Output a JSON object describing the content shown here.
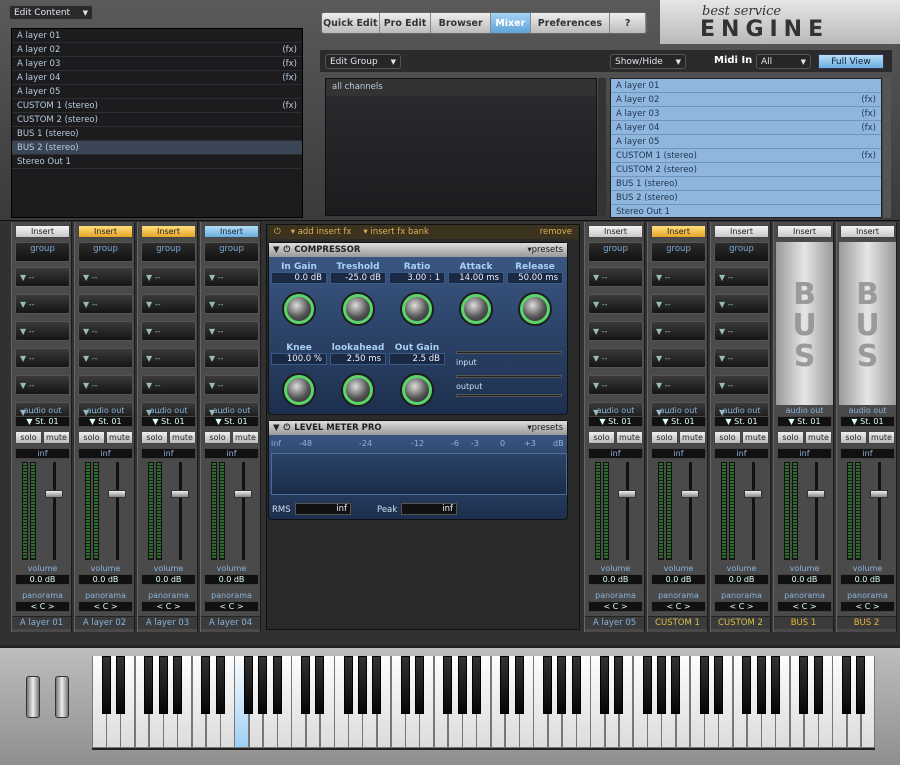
{
  "header": {
    "edit_content": "Edit Content",
    "brand_small": "best service",
    "brand_big": "ENGINE",
    "tabs": [
      {
        "label": "Quick Edit",
        "active": false
      },
      {
        "label": "Pro Edit",
        "active": false
      },
      {
        "label": "Browser",
        "active": false
      },
      {
        "label": "Mixer",
        "active": true
      },
      {
        "label": "Preferences",
        "active": false
      },
      {
        "label": "?",
        "active": false
      }
    ]
  },
  "left_list": [
    {
      "name": "A layer 01",
      "fx": ""
    },
    {
      "name": "A layer 02",
      "fx": "(fx)"
    },
    {
      "name": "A layer 03",
      "fx": "(fx)"
    },
    {
      "name": "A layer 04",
      "fx": "(fx)"
    },
    {
      "name": "A layer 05",
      "fx": ""
    },
    {
      "name": "CUSTOM 1 (stereo)",
      "fx": "(fx)"
    },
    {
      "name": "CUSTOM 2 (stereo)",
      "fx": ""
    },
    {
      "name": "BUS 1 (stereo)",
      "fx": ""
    },
    {
      "name": "BUS 2 (stereo)",
      "fx": ""
    },
    {
      "name": "Stereo Out 1",
      "fx": ""
    }
  ],
  "group_bar": {
    "edit_group": "Edit Group",
    "show_hide": "Show/Hide",
    "midi_in": "Midi In",
    "midi_value": "All",
    "full_view": "Full View",
    "all_channels": "all channels"
  },
  "right_list": [
    {
      "name": "A layer 01",
      "fx": ""
    },
    {
      "name": "A layer 02",
      "fx": "(fx)"
    },
    {
      "name": "A layer 03",
      "fx": "(fx)"
    },
    {
      "name": "A layer 04",
      "fx": "(fx)"
    },
    {
      "name": "A layer 05",
      "fx": ""
    },
    {
      "name": "CUSTOM 1 (stereo)",
      "fx": "(fx)"
    },
    {
      "name": "CUSTOM 2 (stereo)",
      "fx": ""
    },
    {
      "name": "BUS 1 (stereo)",
      "fx": ""
    },
    {
      "name": "BUS 2 (stereo)",
      "fx": ""
    },
    {
      "name": "Stereo Out 1",
      "fx": ""
    }
  ],
  "strip_common": {
    "insert": "Insert",
    "group": "group",
    "slot": "--",
    "audio_out": "audio out",
    "out_val": "St. 01",
    "solo": "solo",
    "mute": "mute",
    "inf": "inf",
    "volume": "volume",
    "vol_val": "0.0 dB",
    "panorama": "panorama",
    "pan_val": "< C >",
    "bus_text": "BUS"
  },
  "strips": [
    {
      "name": "A layer 01",
      "insert": "normal",
      "bus": false,
      "name_color": "#88b3dc"
    },
    {
      "name": "A layer 02",
      "insert": "yellow",
      "bus": false,
      "name_color": "#88b3dc"
    },
    {
      "name": "A layer 03",
      "insert": "yellow",
      "bus": false,
      "name_color": "#88b3dc"
    },
    {
      "name": "A layer 04",
      "insert": "blue",
      "bus": false,
      "name_color": "#88b3dc"
    },
    {
      "name": "A layer 05",
      "insert": "normal",
      "bus": false,
      "name_color": "#88b3dc"
    },
    {
      "name": "CUSTOM 1",
      "insert": "yellow",
      "bus": false,
      "name_color": "#d8c04a"
    },
    {
      "name": "CUSTOM 2",
      "insert": "normal",
      "bus": false,
      "name_color": "#d8c04a"
    },
    {
      "name": "BUS 1",
      "insert": "normal",
      "bus": true,
      "name_color": "#e9b63a"
    },
    {
      "name": "BUS 2",
      "insert": "normal",
      "bus": true,
      "name_color": "#e9b63a"
    }
  ],
  "fx_bar": {
    "add_insert": "add insert fx",
    "insert_bank": "insert fx bank",
    "remove": "remove"
  },
  "compressor": {
    "title": "COMPRESSOR",
    "presets": "presets",
    "params": [
      {
        "label": "In Gain",
        "value": "0.0 dB"
      },
      {
        "label": "Treshold",
        "value": "-25.0 dB"
      },
      {
        "label": "Ratio",
        "value": "3.00 : 1"
      },
      {
        "label": "Attack",
        "value": "14.00 ms"
      },
      {
        "label": "Release",
        "value": "50.00 ms"
      }
    ],
    "params2": [
      {
        "label": "Knee",
        "value": "100.0 %"
      },
      {
        "label": "lookahead",
        "value": "2.50 ms"
      },
      {
        "label": "Out Gain",
        "value": "2.5 dB"
      }
    ],
    "input": "input",
    "output": "output"
  },
  "level_meter": {
    "title": "LEVEL METER PRO",
    "presets": "presets",
    "scale": [
      "inf",
      "-48",
      "-24",
      "-12",
      "-6",
      "-3",
      "0",
      "+3",
      "dB"
    ],
    "rms": "RMS",
    "rms_val": "inf",
    "peak": "Peak",
    "peak_val": "inf"
  }
}
